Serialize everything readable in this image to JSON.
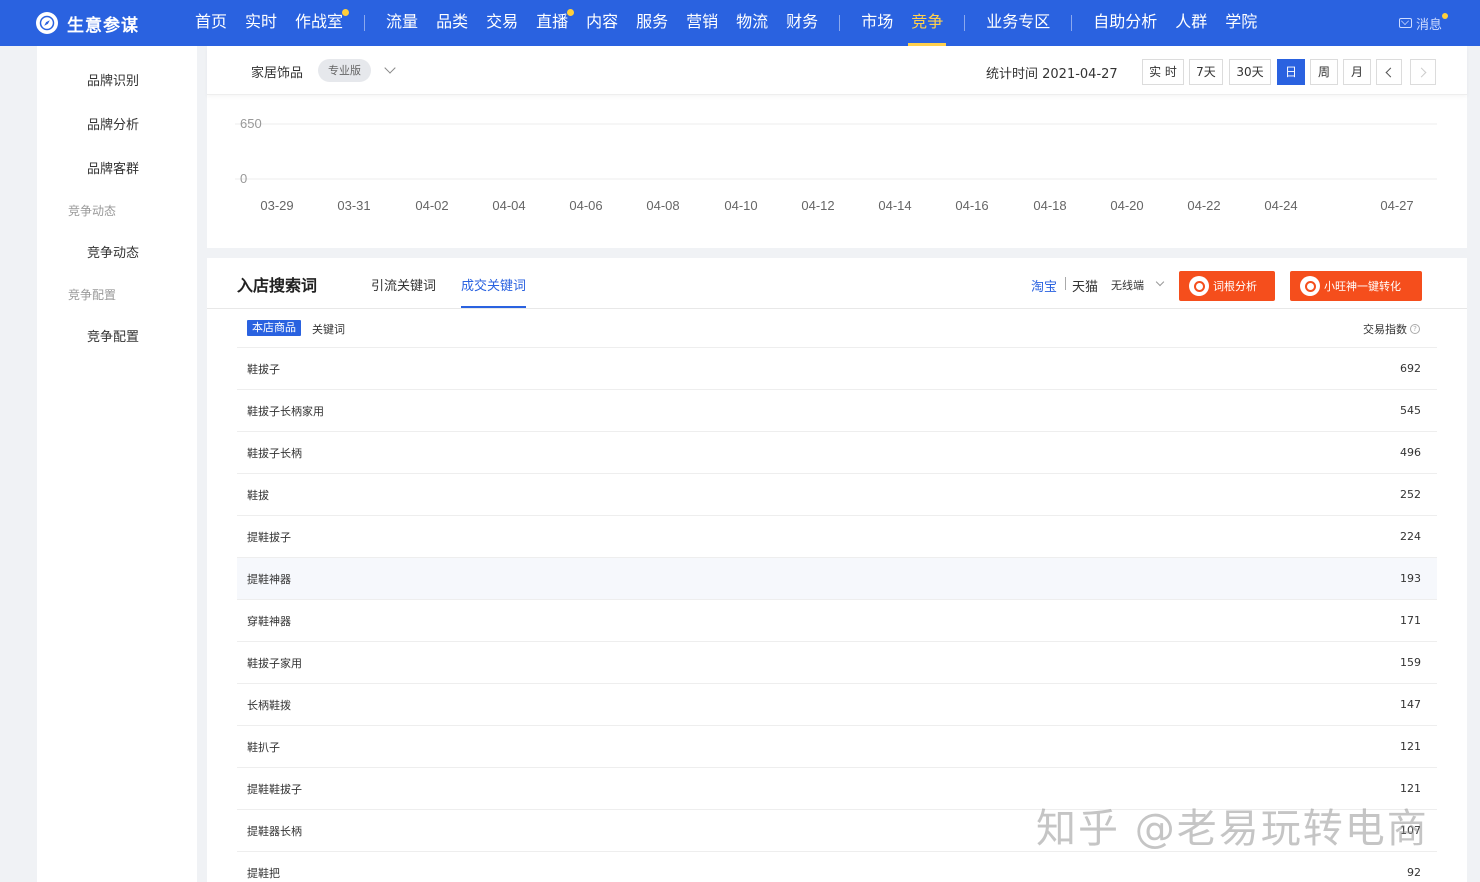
{
  "app": {
    "title": "生意参谋"
  },
  "nav": {
    "items": [
      {
        "label": "首页",
        "dot": false,
        "active": false
      },
      {
        "label": "实时",
        "dot": false,
        "active": false
      },
      {
        "label": "作战室",
        "dot": true,
        "active": false
      },
      {
        "label": "流量",
        "dot": false,
        "active": false
      },
      {
        "label": "品类",
        "dot": false,
        "active": false
      },
      {
        "label": "交易",
        "dot": false,
        "active": false
      },
      {
        "label": "直播",
        "dot": true,
        "active": false
      },
      {
        "label": "内容",
        "dot": false,
        "active": false
      },
      {
        "label": "服务",
        "dot": false,
        "active": false
      },
      {
        "label": "营销",
        "dot": false,
        "active": false
      },
      {
        "label": "物流",
        "dot": false,
        "active": false
      },
      {
        "label": "财务",
        "dot": false,
        "active": false
      },
      {
        "label": "市场",
        "dot": false,
        "active": false
      },
      {
        "label": "竞争",
        "dot": false,
        "active": true
      },
      {
        "label": "业务专区",
        "dot": false,
        "active": false
      },
      {
        "label": "自助分析",
        "dot": false,
        "active": false
      },
      {
        "label": "人群",
        "dot": false,
        "active": false
      },
      {
        "label": "学院",
        "dot": false,
        "active": false
      }
    ],
    "message_label": "消息"
  },
  "sidebar": {
    "brand_recognition": "品牌识别",
    "brand_analysis": "品牌分析",
    "brand_customers": "品牌客群",
    "group_dynamics": "竞争动态",
    "dynamics": "竞争动态",
    "group_config": "竞争配置",
    "config": "竞争配置"
  },
  "filter": {
    "category": "家居饰品",
    "edition": "专业版",
    "stat_time": "统计时间 2021-04-27",
    "periods": [
      "实 时",
      "7天",
      "30天",
      "日",
      "周",
      "月"
    ],
    "active_period": "日"
  },
  "chart_data": {
    "type": "line",
    "x": [
      "03-29",
      "03-31",
      "04-02",
      "04-04",
      "04-06",
      "04-08",
      "04-10",
      "04-12",
      "04-14",
      "04-16",
      "04-18",
      "04-20",
      "04-22",
      "04-24",
      "04-27"
    ],
    "yticks": [
      "650",
      "0"
    ],
    "ylim": [
      0,
      650
    ],
    "grid": true
  },
  "keywords_panel": {
    "title": "入店搜索词",
    "tabs": [
      "引流关键词",
      "成交关键词"
    ],
    "active_tab": "成交关键词",
    "platform_taobao": "淘宝",
    "platform_tmall": "天猫",
    "terminal": "无线端",
    "btn_root_analysis": "词根分析",
    "btn_xiaowang": "小旺神一键转化",
    "sub_tag": "本店商品",
    "sub_keyword": "关键词",
    "col_trade_index": "交易指数",
    "rows": [
      {
        "keyword": "鞋拔子",
        "value": "692"
      },
      {
        "keyword": "鞋拔子长柄家用",
        "value": "545"
      },
      {
        "keyword": "鞋拔子长柄",
        "value": "496"
      },
      {
        "keyword": "鞋拔",
        "value": "252"
      },
      {
        "keyword": "提鞋拔子",
        "value": "224"
      },
      {
        "keyword": "提鞋神器",
        "value": "193"
      },
      {
        "keyword": "穿鞋神器",
        "value": "171"
      },
      {
        "keyword": "鞋拔子家用",
        "value": "159"
      },
      {
        "keyword": "长柄鞋拨",
        "value": "147"
      },
      {
        "keyword": "鞋扒子",
        "value": "121"
      },
      {
        "keyword": "提鞋鞋拔子",
        "value": "121"
      },
      {
        "keyword": "提鞋器长柄",
        "value": "107"
      },
      {
        "keyword": "提鞋把",
        "value": "92"
      }
    ]
  },
  "watermark": "知乎 @老易玩转电商",
  "colors": {
    "brand_blue": "#2a62e0",
    "active_yellow": "#ffd04d",
    "action_orange": "#f54e1c"
  }
}
